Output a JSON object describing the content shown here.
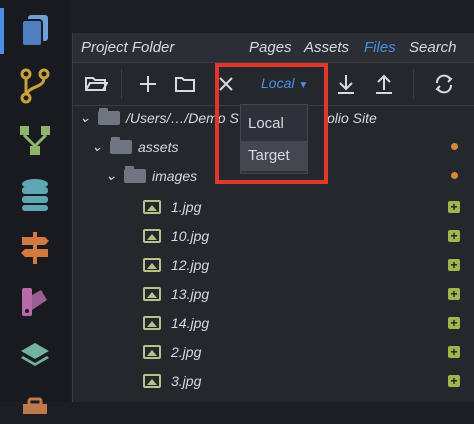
{
  "panel": {
    "title": "Project Folder",
    "nav": [
      "Pages",
      "Assets",
      "Files",
      "Search"
    ],
    "active_nav": "Files"
  },
  "toolbar": {
    "target_select": "Local"
  },
  "target_menu": {
    "items": [
      "Local",
      "Target"
    ],
    "selected": "Target"
  },
  "tree": {
    "root": "/Users/…/Demo S",
    "root_tail": "olio Site",
    "assets": "assets",
    "images": "images",
    "files": [
      "1.jpg",
      "10.jpg",
      "12.jpg",
      "13.jpg",
      "14.jpg",
      "2.jpg",
      "3.jpg"
    ]
  },
  "colors": {
    "accent": "#4a8fe2",
    "highlight": "#e0362c",
    "modified_dot": "#d6873a",
    "added_badge": "#9fb64d"
  },
  "icons": [
    "pages-icon",
    "git-branch-icon",
    "hierarchy-icon",
    "database-icon",
    "signpost-icon",
    "palette-icon",
    "layers-icon"
  ]
}
